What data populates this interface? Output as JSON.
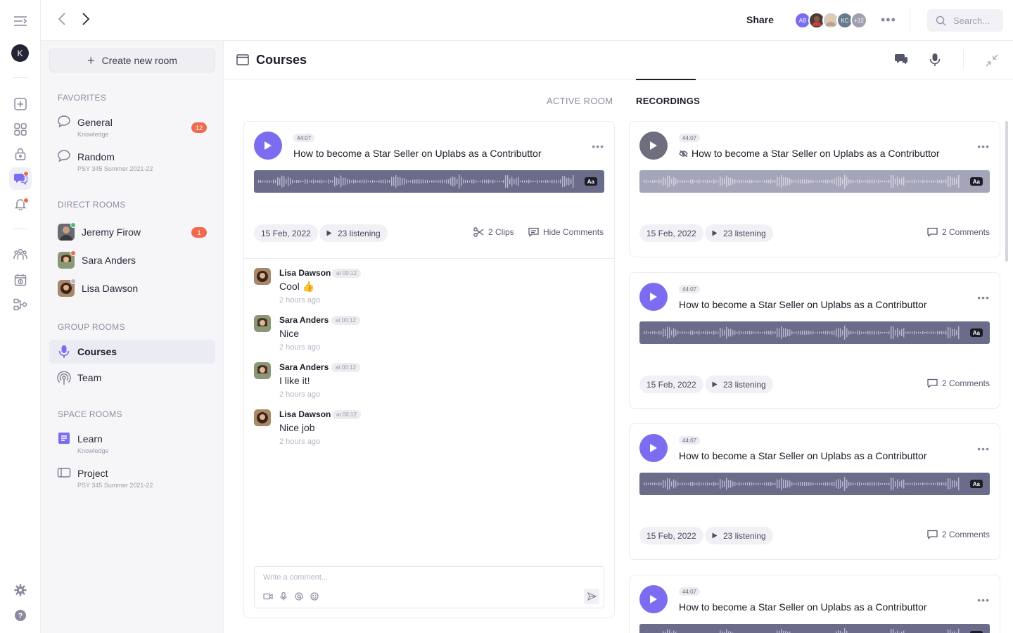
{
  "rail": {
    "user_initial": "K"
  },
  "topbar": {
    "share_label": "Share",
    "avatars": [
      {
        "initials": "AB",
        "color": "#7c6cf0"
      },
      {
        "initials": "",
        "color": "#2c2c3a"
      },
      {
        "initials": "",
        "color": "#b5a89a"
      },
      {
        "initials": "KC",
        "color": "#6a7a8e"
      },
      {
        "initials": "+12",
        "color": "#a0a0b2"
      }
    ],
    "more_label": "•••",
    "search_placeholder": "Search..."
  },
  "sidebar": {
    "create_label": "Create new room",
    "favorites_title": "FAVORITES",
    "favorites": [
      {
        "name": "General",
        "sub": "Knowledge",
        "badge": "12"
      },
      {
        "name": "Random",
        "sub": "PSY 345 Summer 2021-22",
        "badge": ""
      }
    ],
    "direct_title": "DIRECT ROOMS",
    "direct": [
      {
        "name": "Jeremy Firow",
        "badge": "1",
        "status": "online"
      },
      {
        "name": "Sara Anders",
        "badge": "",
        "status": "busy"
      },
      {
        "name": "Lisa Dawson",
        "badge": "",
        "status": "offline"
      }
    ],
    "group_title": "GROUP ROOMS",
    "group": [
      {
        "name": "Courses"
      },
      {
        "name": "Team"
      }
    ],
    "space_title": "SPACE ROOMS",
    "space": [
      {
        "name": "Learn",
        "sub": "Knowledge"
      },
      {
        "name": "Project",
        "sub": "PSY 345 Summer 2021-22"
      }
    ]
  },
  "header": {
    "title": "Courses"
  },
  "tabs": {
    "active_room": "ACTIVE ROOM",
    "recordings": "RECORDINGS"
  },
  "active_card": {
    "duration": "44:07",
    "title": "How to become a Star Seller on Uplabs as a Contributtor",
    "aa": "Aa",
    "date": "15 Feb, 2022",
    "listening": "23 listening",
    "clips": "2 Clips",
    "hide_comments": "Hide Comments",
    "comments": [
      {
        "name": "Lisa Dawson",
        "time": "at 00:12",
        "text": "Cool 👍",
        "ago": "2 hours ago"
      },
      {
        "name": "Sara Anders",
        "time": "at 00:12",
        "text": "Nice",
        "ago": "2 hours ago"
      },
      {
        "name": "Sara Anders",
        "time": "at 00:12",
        "text": "I like it!",
        "ago": "2 hours ago"
      },
      {
        "name": "Lisa Dawson",
        "time": "at 00:12",
        "text": "Nice job",
        "ago": "2 hours ago"
      }
    ],
    "write_placeholder": "Write a comment..."
  },
  "recordings": [
    {
      "duration": "44:07",
      "title": "How to become a Star Seller on Uplabs as a Contributtor",
      "aa": "Aa",
      "date": "15 Feb, 2022",
      "listening": "23 listening",
      "comments": "2 Comments",
      "hidden": true
    },
    {
      "duration": "44:07",
      "title": "How to become a Star Seller on Uplabs as a Contributtor",
      "aa": "Aa",
      "date": "15 Feb, 2022",
      "listening": "23 listening",
      "comments": "2 Comments",
      "hidden": false
    },
    {
      "duration": "44:07",
      "title": "How to become a Star Seller on Uplabs as a Contributtor",
      "aa": "Aa",
      "date": "15 Feb, 2022",
      "listening": "23 listening",
      "comments": "2 Comments",
      "hidden": false
    },
    {
      "duration": "44:07",
      "title": "How to become a Star Seller on Uplabs as a Contributtor",
      "aa": "Aa",
      "date": "",
      "listening": "",
      "comments": "",
      "hidden": false
    }
  ],
  "colors": {
    "accent": "#7c6cf0",
    "badge": "#f06a4d",
    "online": "#3cc47c"
  }
}
